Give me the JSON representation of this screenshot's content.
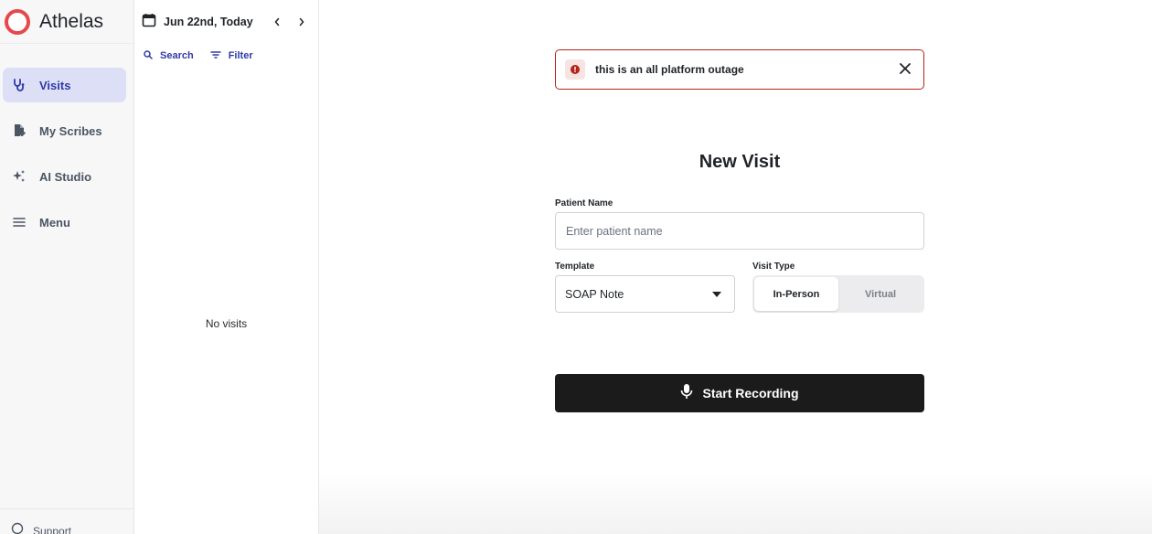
{
  "app": {
    "name": "Athelas"
  },
  "colors": {
    "brand": "#e5484d",
    "accent": "#2f3aa6",
    "alert_border": "#b42318",
    "primary_button": "#1b1b1b"
  },
  "sidebar": {
    "items": [
      {
        "label": "Visits",
        "icon": "stethoscope-icon",
        "active": true
      },
      {
        "label": "My Scribes",
        "icon": "document-edit-icon",
        "active": false
      },
      {
        "label": "AI Studio",
        "icon": "sparkles-icon",
        "active": false
      },
      {
        "label": "Menu",
        "icon": "hamburger-menu-icon",
        "active": false
      }
    ],
    "support_label": "Support"
  },
  "visit_list": {
    "date_label": "Jun 22nd, Today",
    "search_label": "Search",
    "filter_label": "Filter",
    "empty_text": "No visits"
  },
  "alert": {
    "message": "this is an all platform outage"
  },
  "new_visit": {
    "title": "New Visit",
    "patient_name_label": "Patient Name",
    "patient_name_placeholder": "Enter patient name",
    "patient_name_value": "",
    "template_label": "Template",
    "template_value": "SOAP Note",
    "visit_type_label": "Visit Type",
    "visit_type_options": [
      "In-Person",
      "Virtual"
    ],
    "visit_type_selected": "In-Person",
    "record_button_label": "Start Recording"
  }
}
